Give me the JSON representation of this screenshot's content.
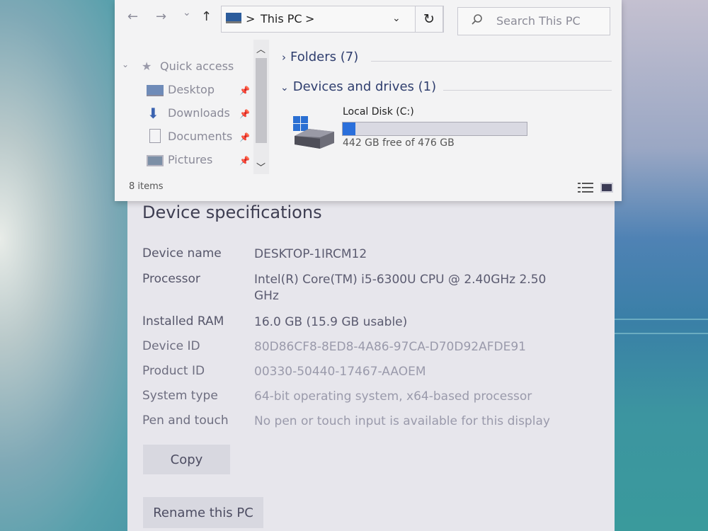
{
  "explorer": {
    "address": {
      "location": "This PC",
      "separator": ">"
    },
    "search_placeholder": "Search This PC",
    "nav_buttons": {
      "back": "←",
      "forward": "→",
      "recent": "⌄",
      "up": "↑",
      "refresh": "↻",
      "dropdown": "⌄"
    },
    "nav_pane": {
      "quick_access": "Quick access",
      "items": [
        {
          "label": "Desktop",
          "icon": "desktop-icon"
        },
        {
          "label": "Downloads",
          "icon": "downloads-icon"
        },
        {
          "label": "Documents",
          "icon": "documents-icon"
        },
        {
          "label": "Pictures",
          "icon": "pictures-icon"
        }
      ]
    },
    "groups": {
      "folders": "Folders (7)",
      "devices": "Devices and drives (1)"
    },
    "drive": {
      "name": "Local Disk (C:)",
      "free_text": "442 GB free of 476 GB",
      "used_fraction": 0.071,
      "bar_color": "#2a6fdb"
    },
    "status": "8 items"
  },
  "settings": {
    "title": "Device specifications",
    "specs": [
      {
        "label": "Device name",
        "value": "DESKTOP-1IRCM12"
      },
      {
        "label": "Processor",
        "value": "Intel(R) Core(TM) i5-6300U CPU @ 2.40GHz   2.50 GHz"
      },
      {
        "label": "Installed RAM",
        "value": "16.0 GB (15.9 GB usable)"
      },
      {
        "label": "Device ID",
        "value": "80D86CF8-8ED8-4A86-97CA-D70D92AFDE91"
      },
      {
        "label": "Product ID",
        "value": "00330-50440-17467-AAOEM"
      },
      {
        "label": "System type",
        "value": "64-bit operating system, x64-based processor"
      },
      {
        "label": "Pen and touch",
        "value": "No pen or touch input is available for this display"
      }
    ],
    "copy_button": "Copy",
    "rename_button": "Rename this PC"
  }
}
